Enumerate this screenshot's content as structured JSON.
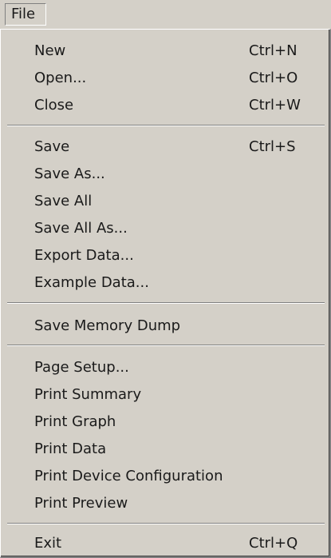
{
  "menubar": {
    "file_label": "File"
  },
  "menu": {
    "new": {
      "label": "New",
      "shortcut": "Ctrl+N"
    },
    "open": {
      "label": "Open...",
      "shortcut": "Ctrl+O"
    },
    "close": {
      "label": "Close",
      "shortcut": "Ctrl+W"
    },
    "save": {
      "label": "Save",
      "shortcut": "Ctrl+S"
    },
    "save_as": {
      "label": "Save As..."
    },
    "save_all": {
      "label": "Save All"
    },
    "save_all_as": {
      "label": "Save All As..."
    },
    "export_data": {
      "label": "Export Data..."
    },
    "example_data": {
      "label": "Example Data..."
    },
    "save_memory_dump": {
      "label": "Save Memory Dump"
    },
    "page_setup": {
      "label": "Page Setup..."
    },
    "print_summary": {
      "label": "Print Summary"
    },
    "print_graph": {
      "label": "Print Graph"
    },
    "print_data": {
      "label": "Print Data"
    },
    "print_device_configuration": {
      "label": "Print Device Configuration"
    },
    "print_preview": {
      "label": "Print Preview"
    },
    "exit": {
      "label": "Exit",
      "shortcut": "Ctrl+Q"
    }
  },
  "colors": {
    "menu_background": "#d4d0c8",
    "text": "#1a1a1a",
    "separator_dark": "#808080",
    "separator_light": "#ffffff"
  }
}
